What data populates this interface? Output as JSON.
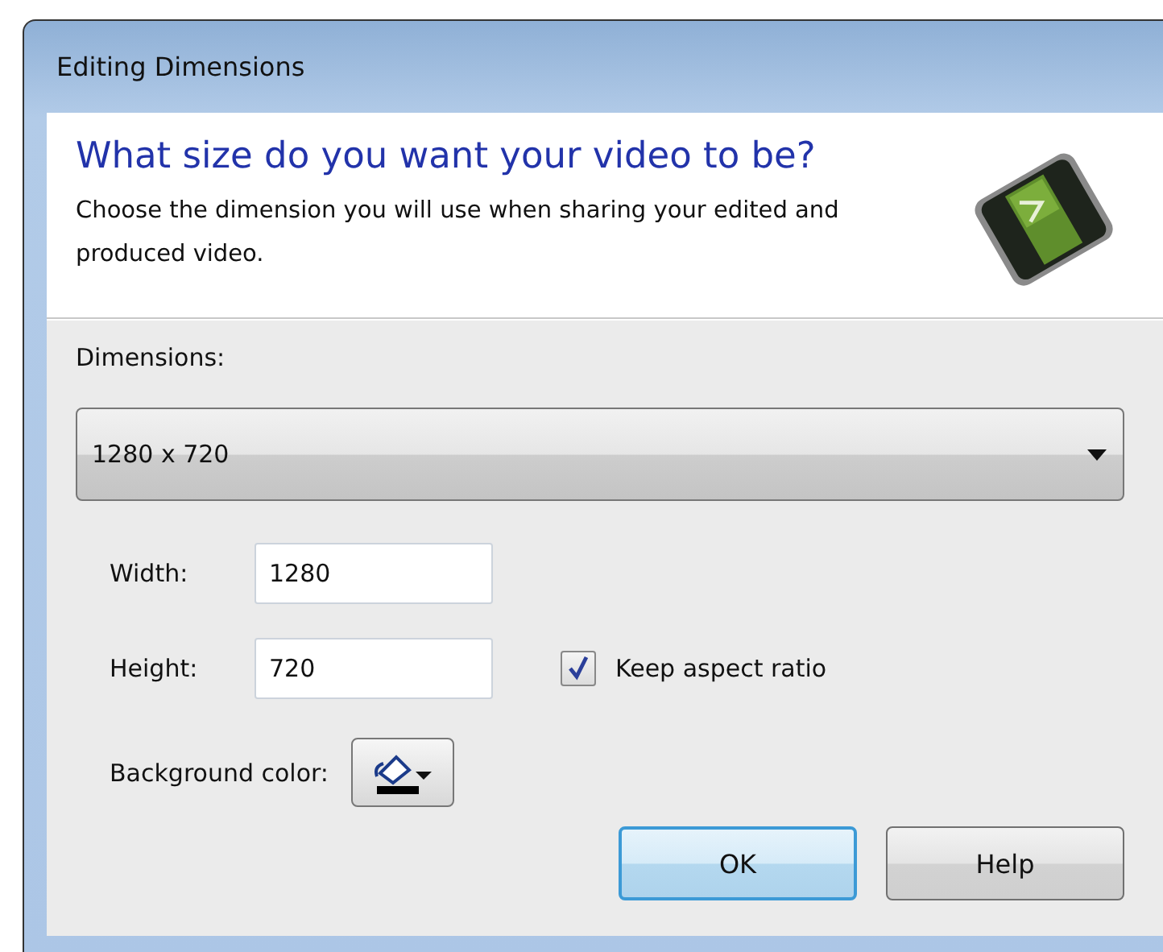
{
  "window": {
    "title": "Editing Dimensions"
  },
  "header": {
    "heading": "What size do you want your video to be?",
    "description": "Choose the dimension you will use when sharing your edited and produced video."
  },
  "dimensions": {
    "label": "Dimensions:",
    "value": "1280 x 720"
  },
  "fields": [
    {
      "label": "Width:",
      "value": "1280"
    },
    {
      "label": "Height:",
      "value": "720"
    }
  ],
  "keep_aspect": {
    "label": "Keep aspect ratio",
    "checked": true
  },
  "background_color": {
    "label": "Background color:"
  },
  "buttons": [
    {
      "label": "OK",
      "default": true
    },
    {
      "label": "Help",
      "default": false
    }
  ]
}
